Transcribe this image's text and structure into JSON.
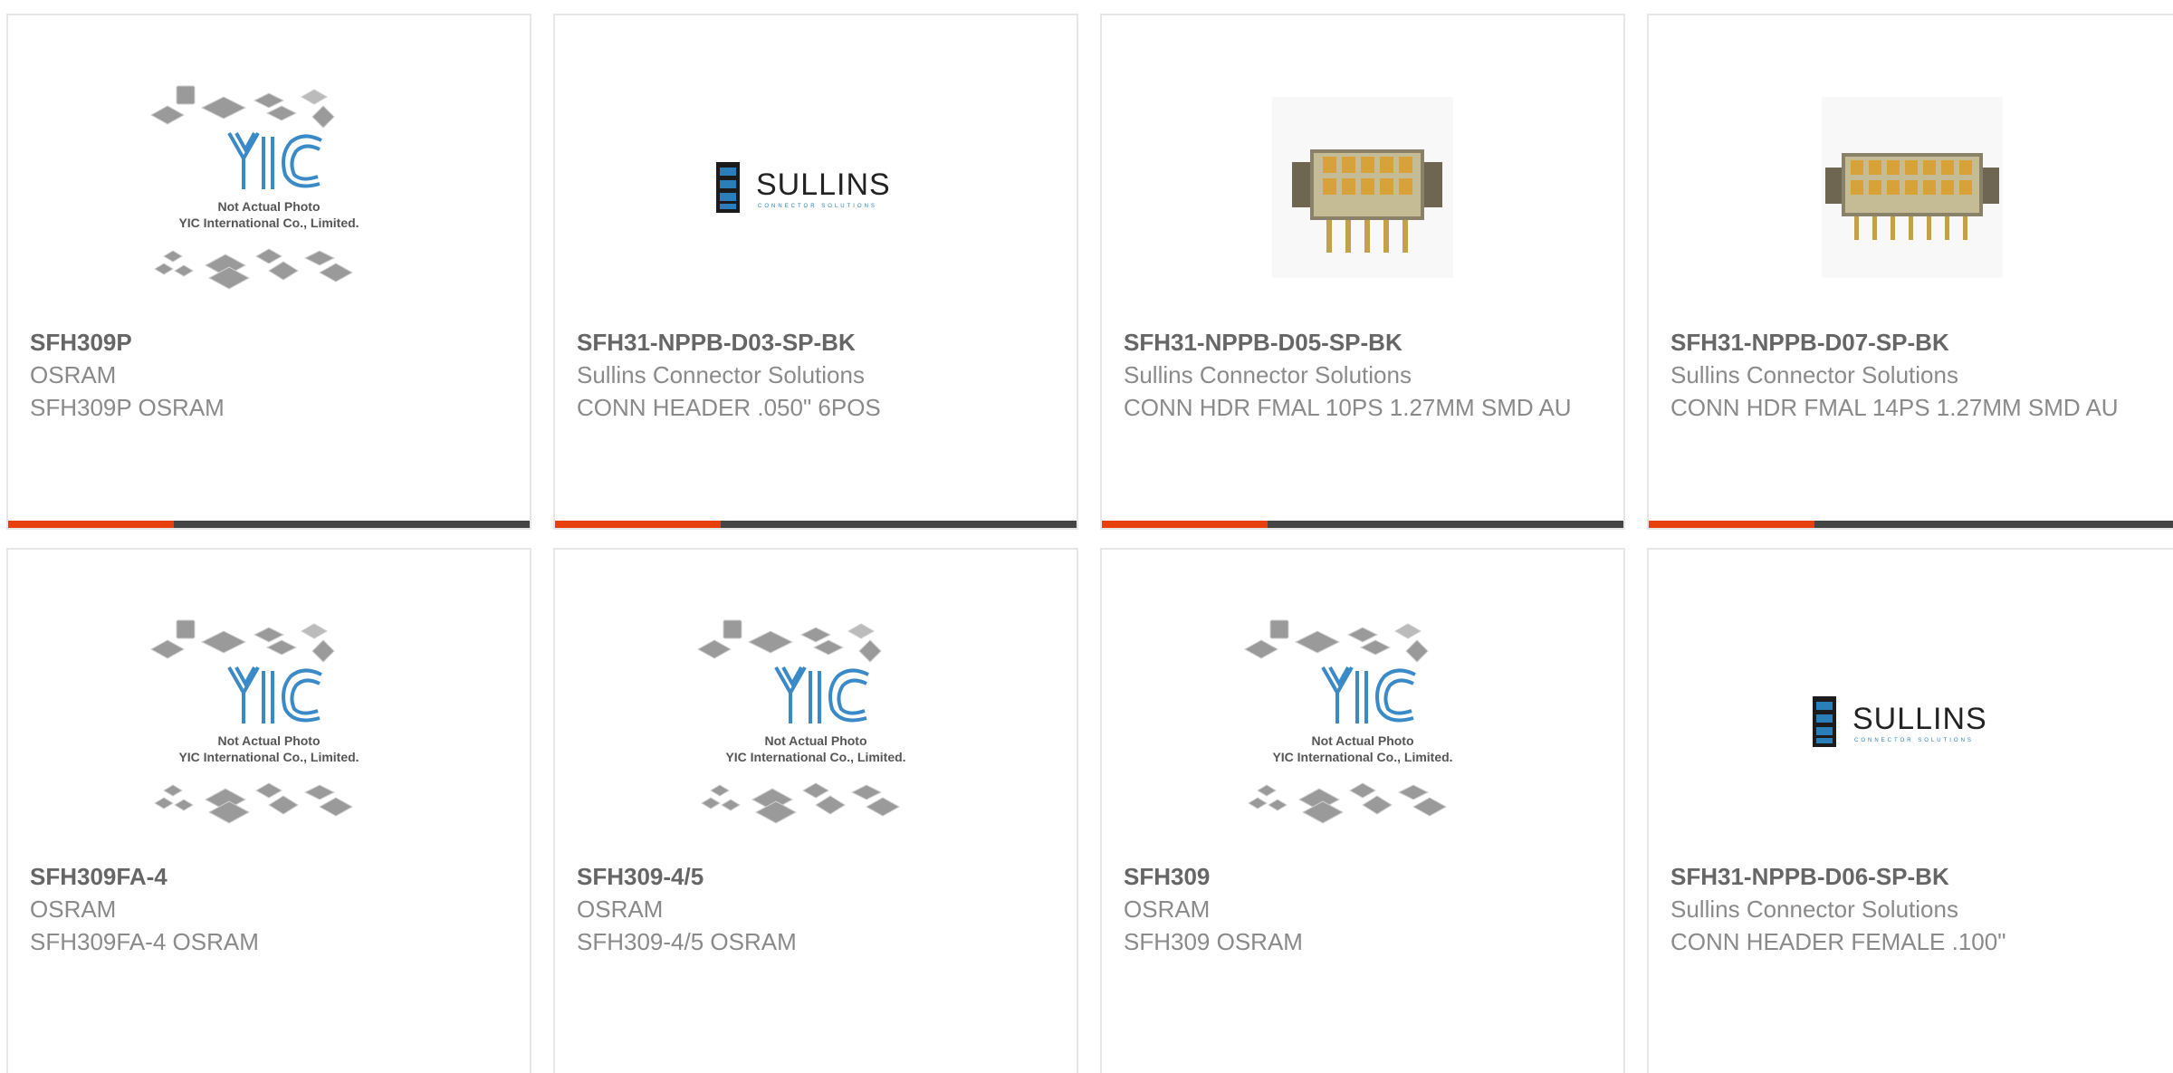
{
  "colors": {
    "accent": "#e8400c",
    "bar_dark": "#444444",
    "yic_blue": "#3a8ac8",
    "sullins_blue": "#2a7fba"
  },
  "placeholder": {
    "logo": "YIC",
    "line1": "Not Actual Photo",
    "line2": "YIC International Co., Limited."
  },
  "sullins_logo": {
    "wordmark": "SULLINS",
    "tagline": "CONNECTOR SOLUTIONS"
  },
  "products": [
    {
      "part": "SFH309P",
      "maker": "OSRAM",
      "desc": "SFH309P OSRAM",
      "image": "yic-placeholder"
    },
    {
      "part": "SFH31-NPPB-D03-SP-BK",
      "maker": "Sullins Connector Solutions",
      "desc": "CONN HEADER .050\" 6POS",
      "image": "sullins-logo"
    },
    {
      "part": "SFH31-NPPB-D05-SP-BK",
      "maker": "Sullins Connector Solutions",
      "desc": "CONN HDR FMAL 10PS 1.27MM SMD AU",
      "image": "connector-photo-10pos"
    },
    {
      "part": "SFH31-NPPB-D07-SP-BK",
      "maker": "Sullins Connector Solutions",
      "desc": "CONN HDR FMAL 14PS 1.27MM SMD AU",
      "image": "connector-photo-14pos"
    },
    {
      "part": "SFH309FA-4",
      "maker": "OSRAM",
      "desc": "SFH309FA-4 OSRAM",
      "image": "yic-placeholder"
    },
    {
      "part": "SFH309-4/5",
      "maker": "OSRAM",
      "desc": "SFH309-4/5 OSRAM",
      "image": "yic-placeholder"
    },
    {
      "part": "SFH309",
      "maker": "OSRAM",
      "desc": "SFH309 OSRAM",
      "image": "yic-placeholder"
    },
    {
      "part": "SFH31-NPPB-D06-SP-BK",
      "maker": "Sullins Connector Solutions",
      "desc": "CONN HEADER FEMALE .100\"",
      "image": "sullins-logo"
    }
  ]
}
